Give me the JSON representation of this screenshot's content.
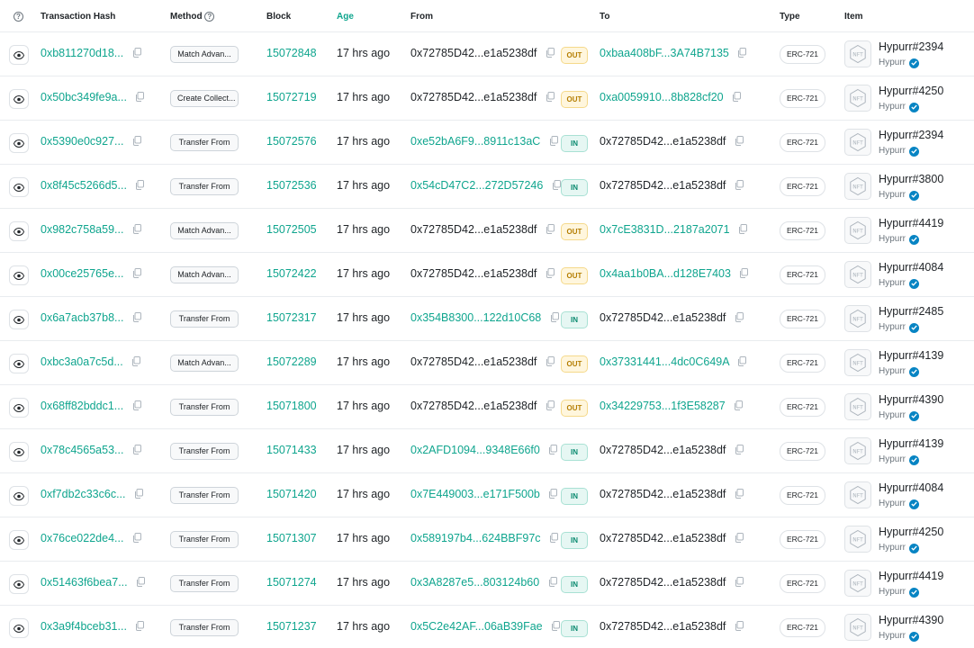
{
  "columns": {
    "hash": "Transaction Hash",
    "method": "Method",
    "block": "Block",
    "age": "Age",
    "from": "From",
    "to": "To",
    "type": "Type",
    "item": "Item"
  },
  "colors": {
    "link": "#0fa58e",
    "out_bg": "#fff6dd",
    "in_bg": "#e6f7f3",
    "verified": "#0784c3"
  },
  "rows": [
    {
      "hash": "0xb811270d18...",
      "method": "Match Advan...",
      "block": "15072848",
      "age": "17 hrs ago",
      "from": "0x72785D42...e1a5238df",
      "from_link": false,
      "dir": "OUT",
      "to": "0xbaa408bF...3A74B7135",
      "to_link": true,
      "type": "ERC-721",
      "item": "Hypurr#2394",
      "collection": "Hypurr"
    },
    {
      "hash": "0x50bc349fe9a...",
      "method": "Create Collect...",
      "block": "15072719",
      "age": "17 hrs ago",
      "from": "0x72785D42...e1a5238df",
      "from_link": false,
      "dir": "OUT",
      "to": "0xa0059910...8b828cf20",
      "to_link": true,
      "type": "ERC-721",
      "item": "Hypurr#4250",
      "collection": "Hypurr"
    },
    {
      "hash": "0x5390e0c927...",
      "method": "Transfer From",
      "block": "15072576",
      "age": "17 hrs ago",
      "from": "0xe52bA6F9...8911c13aC",
      "from_link": true,
      "dir": "IN",
      "to": "0x72785D42...e1a5238df",
      "to_link": false,
      "type": "ERC-721",
      "item": "Hypurr#2394",
      "collection": "Hypurr"
    },
    {
      "hash": "0x8f45c5266d5...",
      "method": "Transfer From",
      "block": "15072536",
      "age": "17 hrs ago",
      "from": "0x54cD47C2...272D57246",
      "from_link": true,
      "dir": "IN",
      "to": "0x72785D42...e1a5238df",
      "to_link": false,
      "type": "ERC-721",
      "item": "Hypurr#3800",
      "collection": "Hypurr"
    },
    {
      "hash": "0x982c758a59...",
      "method": "Match Advan...",
      "block": "15072505",
      "age": "17 hrs ago",
      "from": "0x72785D42...e1a5238df",
      "from_link": false,
      "dir": "OUT",
      "to": "0x7cE3831D...2187a2071",
      "to_link": true,
      "type": "ERC-721",
      "item": "Hypurr#4419",
      "collection": "Hypurr"
    },
    {
      "hash": "0x00ce25765e...",
      "method": "Match Advan...",
      "block": "15072422",
      "age": "17 hrs ago",
      "from": "0x72785D42...e1a5238df",
      "from_link": false,
      "dir": "OUT",
      "to": "0x4aa1b0BA...d128E7403",
      "to_link": true,
      "type": "ERC-721",
      "item": "Hypurr#4084",
      "collection": "Hypurr"
    },
    {
      "hash": "0x6a7acb37b8...",
      "method": "Transfer From",
      "block": "15072317",
      "age": "17 hrs ago",
      "from": "0x354B8300...122d10C68",
      "from_link": true,
      "dir": "IN",
      "to": "0x72785D42...e1a5238df",
      "to_link": false,
      "type": "ERC-721",
      "item": "Hypurr#2485",
      "collection": "Hypurr"
    },
    {
      "hash": "0xbc3a0a7c5d...",
      "method": "Match Advan...",
      "block": "15072289",
      "age": "17 hrs ago",
      "from": "0x72785D42...e1a5238df",
      "from_link": false,
      "dir": "OUT",
      "to": "0x37331441...4dc0C649A",
      "to_link": true,
      "type": "ERC-721",
      "item": "Hypurr#4139",
      "collection": "Hypurr"
    },
    {
      "hash": "0x68ff82bddc1...",
      "method": "Transfer From",
      "block": "15071800",
      "age": "17 hrs ago",
      "from": "0x72785D42...e1a5238df",
      "from_link": false,
      "dir": "OUT",
      "to": "0x34229753...1f3E58287",
      "to_link": true,
      "type": "ERC-721",
      "item": "Hypurr#4390",
      "collection": "Hypurr"
    },
    {
      "hash": "0x78c4565a53...",
      "method": "Transfer From",
      "block": "15071433",
      "age": "17 hrs ago",
      "from": "0x2AFD1094...9348E66f0",
      "from_link": true,
      "dir": "IN",
      "to": "0x72785D42...e1a5238df",
      "to_link": false,
      "type": "ERC-721",
      "item": "Hypurr#4139",
      "collection": "Hypurr"
    },
    {
      "hash": "0xf7db2c33c6c...",
      "method": "Transfer From",
      "block": "15071420",
      "age": "17 hrs ago",
      "from": "0x7E449003...e171F500b",
      "from_link": true,
      "dir": "IN",
      "to": "0x72785D42...e1a5238df",
      "to_link": false,
      "type": "ERC-721",
      "item": "Hypurr#4084",
      "collection": "Hypurr"
    },
    {
      "hash": "0x76ce022de4...",
      "method": "Transfer From",
      "block": "15071307",
      "age": "17 hrs ago",
      "from": "0x589197b4...624BBF97c",
      "from_link": true,
      "dir": "IN",
      "to": "0x72785D42...e1a5238df",
      "to_link": false,
      "type": "ERC-721",
      "item": "Hypurr#4250",
      "collection": "Hypurr"
    },
    {
      "hash": "0x51463f6bea7...",
      "method": "Transfer From",
      "block": "15071274",
      "age": "17 hrs ago",
      "from": "0x3A8287e5...803124b60",
      "from_link": true,
      "dir": "IN",
      "to": "0x72785D42...e1a5238df",
      "to_link": false,
      "type": "ERC-721",
      "item": "Hypurr#4419",
      "collection": "Hypurr"
    },
    {
      "hash": "0x3a9f4bceb31...",
      "method": "Transfer From",
      "block": "15071237",
      "age": "17 hrs ago",
      "from": "0x5C2e42AF...06aB39Fae",
      "from_link": true,
      "dir": "IN",
      "to": "0x72785D42...e1a5238df",
      "to_link": false,
      "type": "ERC-721",
      "item": "Hypurr#4390",
      "collection": "Hypurr"
    }
  ]
}
